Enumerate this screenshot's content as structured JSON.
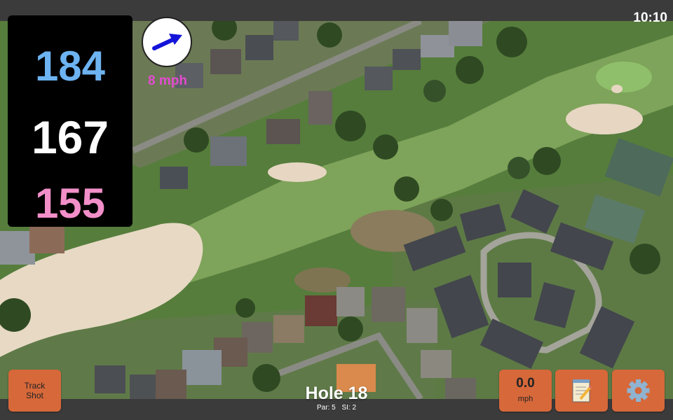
{
  "status_bar": {
    "time": "10:10"
  },
  "distances": {
    "back": "184",
    "middle": "167",
    "front": "155"
  },
  "wind": {
    "speed": "8 mph",
    "direction_icon": "arrow-right-up-icon"
  },
  "hole": {
    "title": "Hole 18",
    "par": "Par: 5",
    "si": "SI: 2"
  },
  "buttons": {
    "track_shot": "Track Shot",
    "speed_value": "0.0",
    "speed_unit": "mph",
    "notes_icon": "notepad-icon",
    "settings_icon": "gear-icon"
  },
  "colors": {
    "back_distance": "#6db3f2",
    "middle_distance": "#ffffff",
    "front_distance": "#f28fc9",
    "wind_text": "#e34bd0",
    "button": "#d6683a"
  }
}
